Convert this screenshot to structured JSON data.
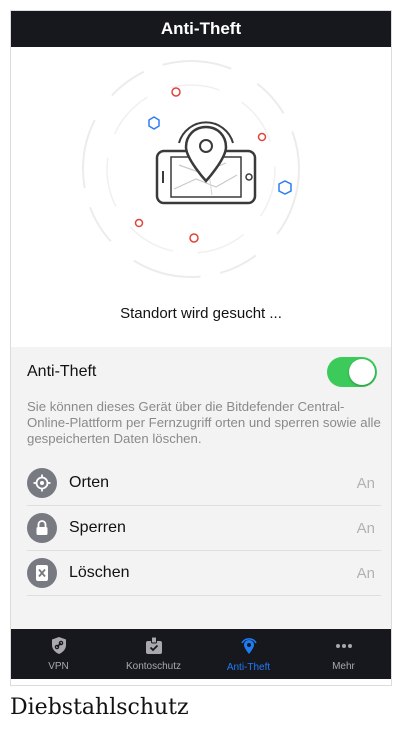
{
  "header": {
    "title": "Anti-Theft"
  },
  "hero": {
    "status": "Standort wird gesucht ..."
  },
  "anti_theft": {
    "label": "Anti-Theft",
    "enabled": true,
    "description": "Sie können dieses Gerät über die Bitdefender Central-Online-Plattform per Fernzugriff orten und sperren sowie alle gespeicherten Daten löschen."
  },
  "features": [
    {
      "label": "Orten",
      "value": "An",
      "icon": "locate-icon"
    },
    {
      "label": "Sperren",
      "value": "An",
      "icon": "lock-icon"
    },
    {
      "label": "Löschen",
      "value": "An",
      "icon": "wipe-icon"
    }
  ],
  "tabbar": {
    "tabs": [
      {
        "label": "VPN",
        "icon": "vpn-shield-icon"
      },
      {
        "label": "Kontoschutz",
        "icon": "account-protection-icon"
      },
      {
        "label": "Anti-Theft",
        "icon": "location-pin-icon"
      },
      {
        "label": "Mehr",
        "icon": "more-dots-icon"
      }
    ],
    "active_index": 2
  },
  "caption": "Diebstahlschutz",
  "colors": {
    "accent": "#1e7cf5",
    "toggle_on": "#3ccb5a",
    "header_bg": "#17181d"
  }
}
